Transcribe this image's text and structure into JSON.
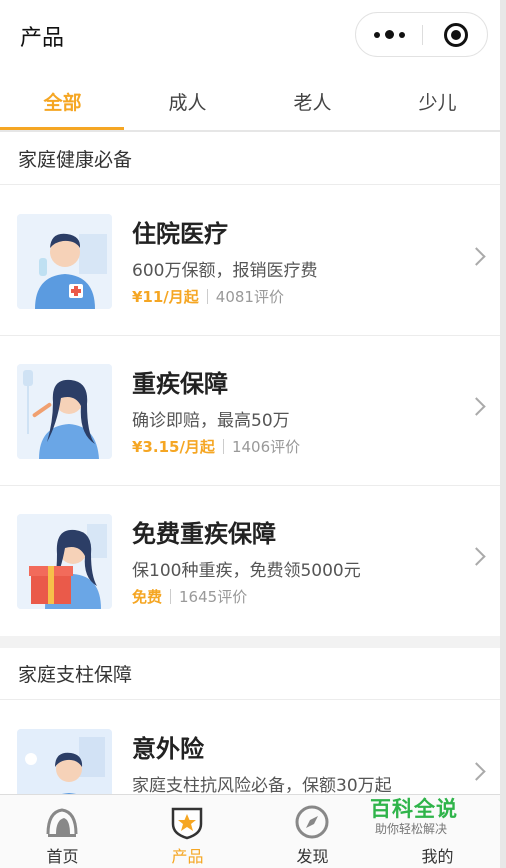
{
  "header": {
    "title": "产品"
  },
  "tabs": [
    {
      "label": "全部",
      "active": true
    },
    {
      "label": "成人",
      "active": false
    },
    {
      "label": "老人",
      "active": false
    },
    {
      "label": "少儿",
      "active": false
    }
  ],
  "sections": [
    {
      "title": "家庭健康必备",
      "items": [
        {
          "name": "住院医疗",
          "desc": "600万保额，报销医疗费",
          "price": "¥11/月起",
          "reviews": "4081评价",
          "icon": "doctor-illustration-icon"
        },
        {
          "name": "重疾保障",
          "desc": "确诊即赔，最高50万",
          "price": "¥3.15/月起",
          "reviews": "1406评价",
          "icon": "patient-illustration-icon"
        },
        {
          "name": "免费重疾保障",
          "desc": "保100种重疾，免费领5000元",
          "price": "免费",
          "reviews": "1645评价",
          "icon": "gift-illustration-icon"
        }
      ]
    },
    {
      "title": "家庭支柱保障",
      "items": [
        {
          "name": "意外险",
          "desc": "家庭支柱抗风险必备，保额30万起",
          "icon": "man-illustration-icon"
        }
      ]
    }
  ],
  "tabbar": [
    {
      "label": "首页",
      "icon": "home-icon",
      "active": false
    },
    {
      "label": "产品",
      "icon": "shield-star-icon",
      "active": true
    },
    {
      "label": "发现",
      "icon": "compass-icon",
      "active": false
    },
    {
      "label": "我的",
      "icon": "user-icon",
      "active": false
    }
  ],
  "watermark": {
    "line1": "百科全说",
    "line2": "助你轻松解决"
  },
  "colors": {
    "accent": "#f5a623",
    "watermark": "#2fb44a"
  }
}
